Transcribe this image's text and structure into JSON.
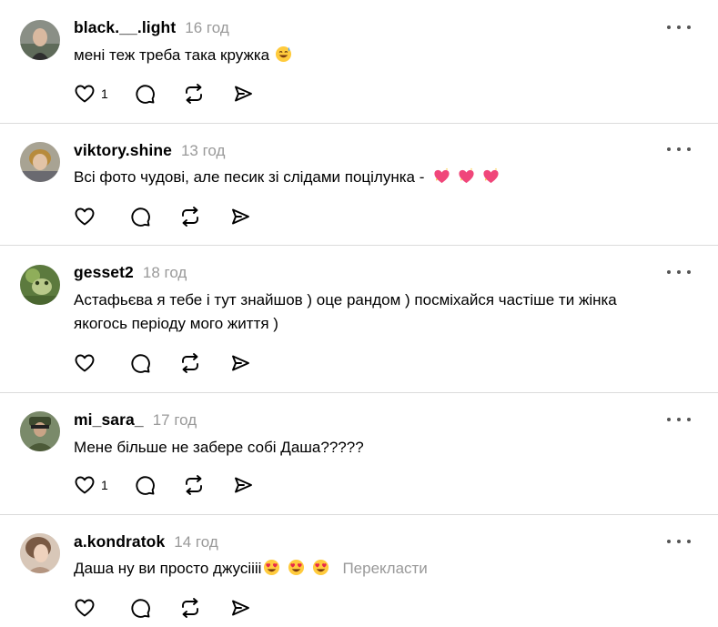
{
  "comments": [
    {
      "username": "black.__.light",
      "time": "16 год",
      "text": "мені теж треба така кружка",
      "like_count": "1",
      "emojis": [
        "smiling-sweat-emoji"
      ],
      "translate": ""
    },
    {
      "username": "viktory.shine",
      "time": "13 год",
      "text": "Всі фото чудові, але песик зі слідами поцілунка -",
      "like_count": "",
      "emojis": [
        "sparkling-heart-emoji",
        "sparkling-heart-emoji",
        "sparkling-heart-emoji"
      ],
      "translate": ""
    },
    {
      "username": "gesset2",
      "time": "18 год",
      "text": "Астафьєва я тебе і тут знайшов ) оце рандом ) посміхайся частіше ти жінка якогось періоду мого життя )",
      "like_count": "",
      "emojis": [],
      "translate": ""
    },
    {
      "username": "mi_sara_",
      "time": "17 год",
      "text": "Мене більше не забере собі Даша?????",
      "like_count": "1",
      "emojis": [],
      "translate": ""
    },
    {
      "username": "a.kondratok",
      "time": "14 год",
      "text": "Даша ну ви просто джусіііі",
      "like_count": "",
      "emojis": [
        "heart-eyes-emoji",
        "heart-eyes-emoji",
        "heart-eyes-emoji"
      ],
      "translate": "Перекласти"
    }
  ],
  "icons": {
    "like": "heart-outline-icon",
    "reply": "speech-bubble-icon",
    "repost": "repost-arrows-icon",
    "share": "paper-plane-icon",
    "more": "more-dots-icon"
  },
  "colors": {
    "text": "#000000",
    "muted": "#999999",
    "divider": "#dbdbdb"
  }
}
